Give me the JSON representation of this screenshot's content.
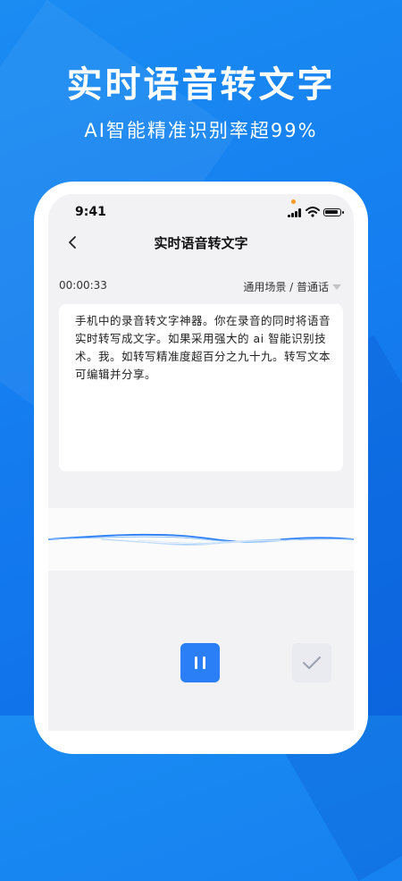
{
  "promo": {
    "headline": "实时语音转文字",
    "subline": "AI智能精准识别率超99%"
  },
  "statusbar": {
    "time": "9:41",
    "icons": [
      "signal-icon",
      "wifi-icon",
      "battery-icon"
    ]
  },
  "navbar": {
    "back_icon": "chevron-left-icon",
    "title": "实时语音转文字"
  },
  "recording": {
    "elapsed": "00:00:33",
    "mode_label": "通用场景 / 普通话"
  },
  "transcript": {
    "text": "手机中的录音转文字神器。你在录音的同时将语音实时转写成文字。如果采用强大的 ai 智能识别技术。我。如转写精准度超百分之九十九。转写文本可编辑并分享。"
  },
  "controls": {
    "pause_icon": "pause-icon",
    "confirm_icon": "check-icon"
  },
  "colors": {
    "brand_blue": "#1a8cf2",
    "button_blue": "#2a7ef6",
    "wave_blue": "#2a7ef6"
  }
}
